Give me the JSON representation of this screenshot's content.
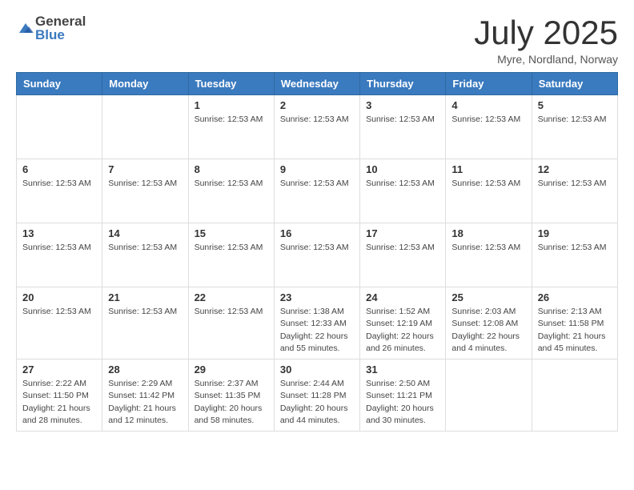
{
  "logo": {
    "general": "General",
    "blue": "Blue"
  },
  "title": "July 2025",
  "location": "Myre, Nordland, Norway",
  "weekdays": [
    "Sunday",
    "Monday",
    "Tuesday",
    "Wednesday",
    "Thursday",
    "Friday",
    "Saturday"
  ],
  "weeks": [
    [
      {
        "day": "",
        "detail": ""
      },
      {
        "day": "",
        "detail": ""
      },
      {
        "day": "1",
        "detail": "Sunrise: 12:53 AM"
      },
      {
        "day": "2",
        "detail": "Sunrise: 12:53 AM"
      },
      {
        "day": "3",
        "detail": "Sunrise: 12:53 AM"
      },
      {
        "day": "4",
        "detail": "Sunrise: 12:53 AM"
      },
      {
        "day": "5",
        "detail": "Sunrise: 12:53 AM"
      }
    ],
    [
      {
        "day": "6",
        "detail": "Sunrise: 12:53 AM"
      },
      {
        "day": "7",
        "detail": "Sunrise: 12:53 AM"
      },
      {
        "day": "8",
        "detail": "Sunrise: 12:53 AM"
      },
      {
        "day": "9",
        "detail": "Sunrise: 12:53 AM"
      },
      {
        "day": "10",
        "detail": "Sunrise: 12:53 AM"
      },
      {
        "day": "11",
        "detail": "Sunrise: 12:53 AM"
      },
      {
        "day": "12",
        "detail": "Sunrise: 12:53 AM"
      }
    ],
    [
      {
        "day": "13",
        "detail": "Sunrise: 12:53 AM"
      },
      {
        "day": "14",
        "detail": "Sunrise: 12:53 AM"
      },
      {
        "day": "15",
        "detail": "Sunrise: 12:53 AM"
      },
      {
        "day": "16",
        "detail": "Sunrise: 12:53 AM"
      },
      {
        "day": "17",
        "detail": "Sunrise: 12:53 AM"
      },
      {
        "day": "18",
        "detail": "Sunrise: 12:53 AM"
      },
      {
        "day": "19",
        "detail": "Sunrise: 12:53 AM"
      }
    ],
    [
      {
        "day": "20",
        "detail": "Sunrise: 12:53 AM"
      },
      {
        "day": "21",
        "detail": "Sunrise: 12:53 AM"
      },
      {
        "day": "22",
        "detail": "Sunrise: 12:53 AM"
      },
      {
        "day": "23",
        "detail": "Sunrise: 1:38 AM\nSunset: 12:33 AM\nDaylight: 22 hours and 55 minutes."
      },
      {
        "day": "24",
        "detail": "Sunrise: 1:52 AM\nSunset: 12:19 AM\nDaylight: 22 hours and 26 minutes."
      },
      {
        "day": "25",
        "detail": "Sunrise: 2:03 AM\nSunset: 12:08 AM\nDaylight: 22 hours and 4 minutes."
      },
      {
        "day": "26",
        "detail": "Sunrise: 2:13 AM\nSunset: 11:58 PM\nDaylight: 21 hours and 45 minutes."
      }
    ],
    [
      {
        "day": "27",
        "detail": "Sunrise: 2:22 AM\nSunset: 11:50 PM\nDaylight: 21 hours and 28 minutes."
      },
      {
        "day": "28",
        "detail": "Sunrise: 2:29 AM\nSunset: 11:42 PM\nDaylight: 21 hours and 12 minutes."
      },
      {
        "day": "29",
        "detail": "Sunrise: 2:37 AM\nSunset: 11:35 PM\nDaylight: 20 hours and 58 minutes."
      },
      {
        "day": "30",
        "detail": "Sunrise: 2:44 AM\nSunset: 11:28 PM\nDaylight: 20 hours and 44 minutes."
      },
      {
        "day": "31",
        "detail": "Sunrise: 2:50 AM\nSunset: 11:21 PM\nDaylight: 20 hours and 30 minutes."
      },
      {
        "day": "",
        "detail": ""
      },
      {
        "day": "",
        "detail": ""
      }
    ]
  ]
}
